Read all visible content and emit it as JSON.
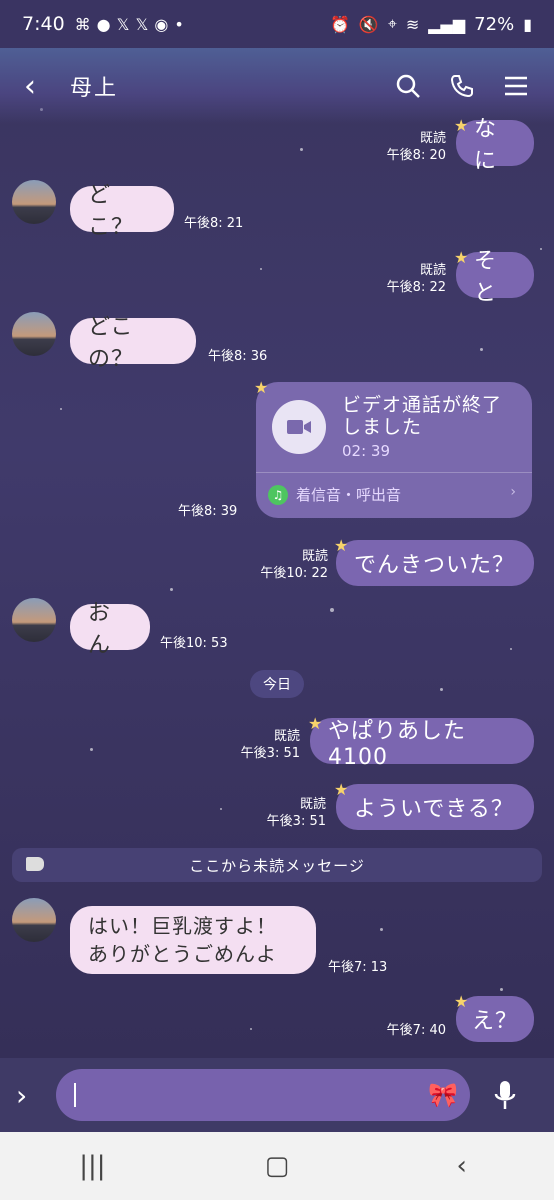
{
  "status": {
    "time": "7:40",
    "battery": "72%"
  },
  "header": {
    "title": "母上"
  },
  "messages": {
    "m1": {
      "text": "なに",
      "read": "既読",
      "time": "午後8: 20"
    },
    "m2": {
      "text": "どこ？",
      "time": "午後8: 21"
    },
    "m3": {
      "text": "そと",
      "read": "既読",
      "time": "午後8: 22"
    },
    "m4": {
      "text": "どこの？",
      "time": "午後8: 36"
    },
    "m5": {
      "title_line1": "ビデオ通話が終了",
      "title_line2": "しました",
      "duration": "02: 39",
      "ringtone": "着信音・呼出音",
      "time": "午後8: 39"
    },
    "m6": {
      "text": "でんきついた？",
      "read": "既読",
      "time": "午後10: 22"
    },
    "m7": {
      "text": "おん",
      "time": "午後10: 53"
    },
    "m8": {
      "text": "やぱりあした4100",
      "read": "既読",
      "time": "午後3: 51"
    },
    "m9": {
      "text": "よういできる？",
      "read": "既読",
      "time": "午後3: 51"
    },
    "m10": {
      "line1": "はい！巨乳渡すよ！",
      "line2": "ありがとうごめんよ",
      "time": "午後7: 13"
    },
    "m11": {
      "text": "え？",
      "time": "午後7: 40"
    }
  },
  "date_separator": "今日",
  "unread_label": "ここから未読メッセージ",
  "input": {
    "placeholder": ""
  },
  "colors": {
    "outgoing_bubble": "#7b66b0",
    "incoming_bubble": "#f4dff2",
    "star": "#f7d36b"
  }
}
